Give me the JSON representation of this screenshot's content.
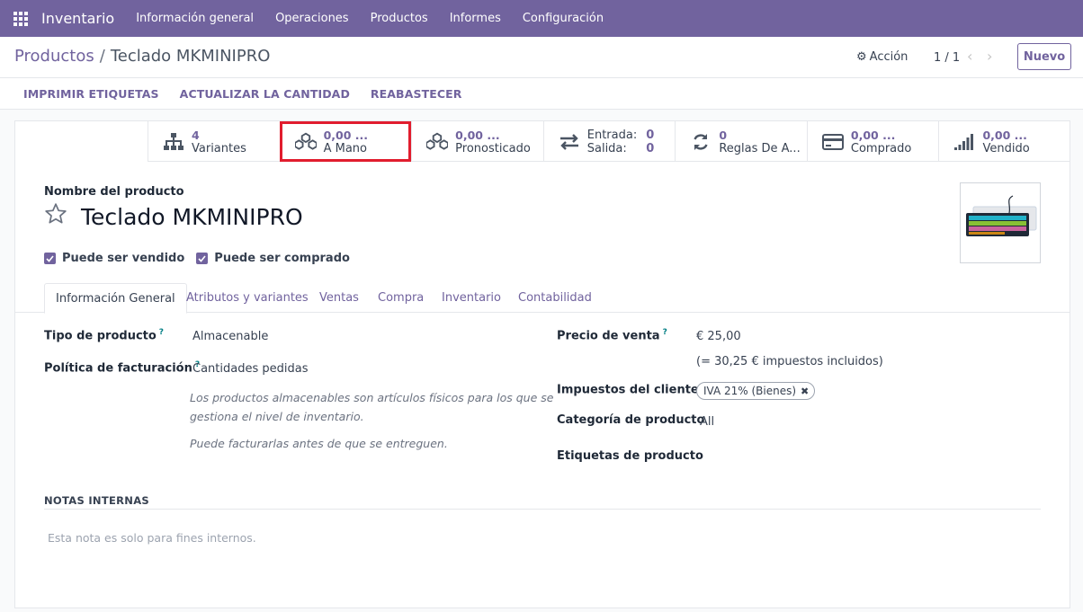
{
  "navbar": {
    "app_name": "Inventario",
    "menu": [
      "Información general",
      "Operaciones",
      "Productos",
      "Informes",
      "Configuración"
    ]
  },
  "breadcrumb": {
    "root": "Productos",
    "separator": "/",
    "current": "Teclado MKMINIPRO"
  },
  "control": {
    "action_label": "Acción",
    "pager": "1 / 1",
    "new_label": "Nuevo"
  },
  "statusbar": {
    "buttons": [
      "IMPRIMIR ETIQUETAS",
      "ACTUALIZAR LA CANTIDAD",
      "REABASTECER"
    ]
  },
  "stats": {
    "variants": {
      "value": "4",
      "label": "Variantes"
    },
    "on_hand": {
      "value": "0,00 ...",
      "label": "A Mano"
    },
    "forecast": {
      "value": "0,00 ...",
      "label": "Pronosticado"
    },
    "moves": {
      "in_label": "Entrada:",
      "in_value": "0",
      "out_label": "Salida:",
      "out_value": "0"
    },
    "rules": {
      "value": "0",
      "label": "Reglas De A..."
    },
    "purchased": {
      "value": "0,00 ...",
      "label": "Comprado"
    },
    "sold": {
      "value": "0,00 ...",
      "label": "Vendido"
    }
  },
  "product": {
    "name_label": "Nombre del producto",
    "name": "Teclado MKMINIPRO",
    "can_be_sold": "Puede ser vendido",
    "can_be_purchased": "Puede ser comprado"
  },
  "tabs": [
    "Información General",
    "Atributos y variantes",
    "Ventas",
    "Compra",
    "Inventario",
    "Contabilidad"
  ],
  "general": {
    "type_label": "Tipo de producto",
    "type_value": "Almacenable",
    "invoice_label": "Política de facturación",
    "invoice_value": "Cantidades pedidas",
    "help_1_line1": "Los productos almacenables son artículos físicos para los que se",
    "help_1_line2": "gestiona el nivel de inventario.",
    "help_2": "Puede facturarlas antes de que se entreguen.",
    "price_label": "Precio de venta",
    "price_value": "€ 25,00",
    "price_tax_included": "(= 30,25 € impuestos incluidos)",
    "taxes_label": "Impuestos del cliente",
    "tax_tag": "IVA 21% (Bienes)",
    "category_label": "Categoría de producto",
    "category_value": "All",
    "tags_label": "Etiquetas de producto",
    "tooltip_mark": "?"
  },
  "notes": {
    "heading": "NOTAS INTERNAS",
    "placeholder": "Esta nota es solo para fines internos."
  },
  "colors": {
    "brand": "#71639e",
    "highlight": "#e11d2e",
    "tooltip": "#017e84"
  }
}
